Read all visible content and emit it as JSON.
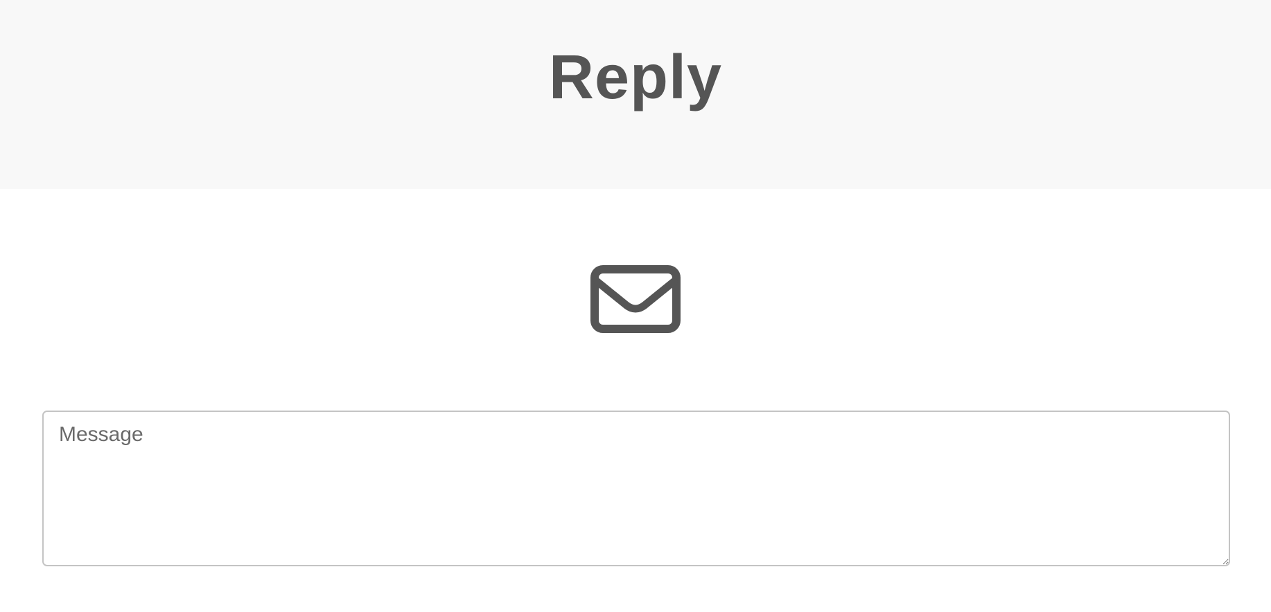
{
  "header": {
    "title": "Reply"
  },
  "icon": {
    "name": "envelope-icon",
    "color": "#555555"
  },
  "message": {
    "placeholder": "Message",
    "value": ""
  },
  "colors": {
    "header_background": "#f8f8f8",
    "text": "#555555",
    "input_border": "#c4c4c4"
  }
}
